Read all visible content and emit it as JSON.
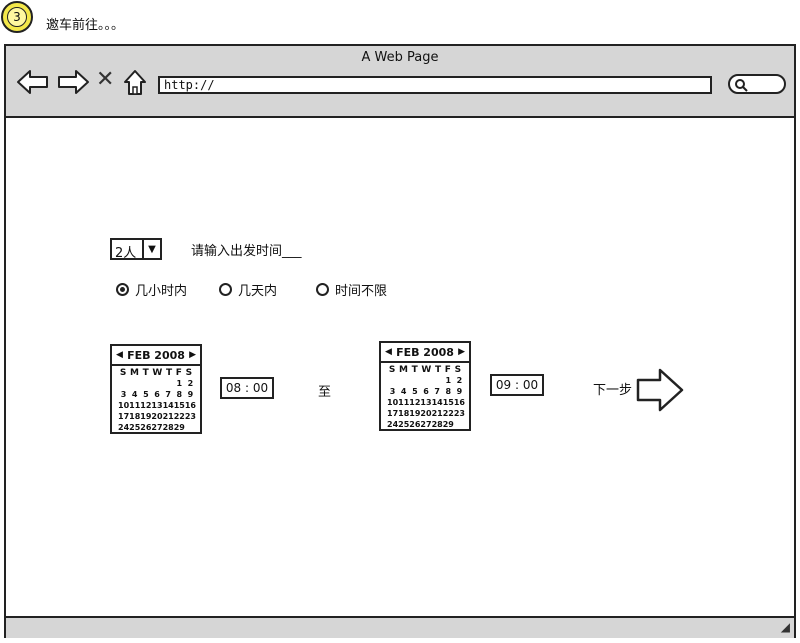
{
  "header": {
    "step_number": "3",
    "title": "邀车前往。。。"
  },
  "browser": {
    "window_title": "A Web Page",
    "url": "http://",
    "nav_icons": [
      "back-arrow-icon",
      "forward-arrow-icon",
      "close-icon",
      "home-icon"
    ]
  },
  "form": {
    "people_count": "2人",
    "prompt": "请输入出发时间___",
    "radio_options": [
      {
        "label": "几小时内",
        "selected": true
      },
      {
        "label": "几天内",
        "selected": false
      },
      {
        "label": "时间不限",
        "selected": false
      }
    ],
    "start": {
      "calendar": {
        "month": "FEB 2008",
        "weekdays": [
          "S",
          "M",
          "T",
          "W",
          "T",
          "F",
          "S"
        ],
        "weeks": [
          [
            "",
            "",
            "",
            "",
            "",
            "1",
            "2"
          ],
          [
            "3",
            "4",
            "5",
            "6",
            "7",
            "8",
            "9"
          ],
          [
            "10",
            "11",
            "12",
            "13",
            "14",
            "15",
            "16"
          ],
          [
            "17",
            "18",
            "19",
            "20",
            "21",
            "22",
            "23"
          ],
          [
            "24",
            "25",
            "26",
            "27",
            "28",
            "29",
            ""
          ]
        ]
      },
      "time": "08 : 00"
    },
    "to_label": "至",
    "end": {
      "calendar": {
        "month": "FEB 2008",
        "weekdays": [
          "S",
          "M",
          "T",
          "W",
          "T",
          "F",
          "S"
        ],
        "weeks": [
          [
            "",
            "",
            "",
            "",
            "",
            "1",
            "2"
          ],
          [
            "3",
            "4",
            "5",
            "6",
            "7",
            "8",
            "9"
          ],
          [
            "10",
            "11",
            "12",
            "13",
            "14",
            "15",
            "16"
          ],
          [
            "17",
            "18",
            "19",
            "20",
            "21",
            "22",
            "23"
          ],
          [
            "24",
            "25",
            "26",
            "27",
            "28",
            "29",
            ""
          ]
        ]
      },
      "time": "09 : 00"
    },
    "next_label": "下一步"
  }
}
